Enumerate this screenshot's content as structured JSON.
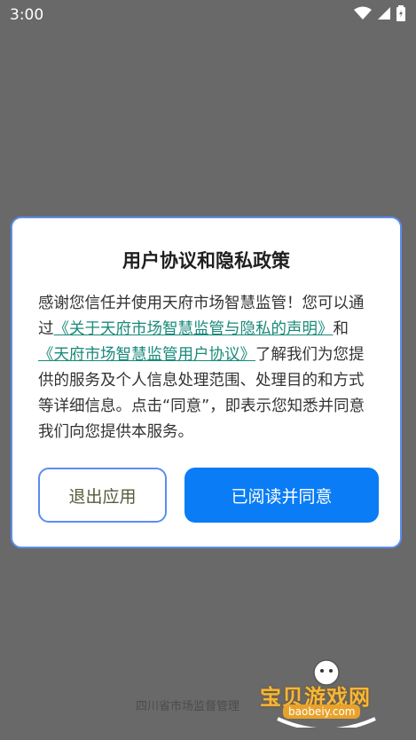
{
  "status_bar": {
    "time": "3:00"
  },
  "dialog": {
    "title": "用户协议和隐私政策",
    "body": {
      "intro": "感谢您信任并使用天府市场智慧监管！您可以通过",
      "link1": "《关于天府市场智慧监管与隐私的声明》",
      "connector": "和",
      "link2": "《天府市场智慧监管用户协议》",
      "rest": "了解我们为您提供的服务及个人信息处理范围、处理目的和方式等详细信息。点击“同意”，即表示您知悉并同意我们向您提供本服务。"
    },
    "exit_label": "退出应用",
    "agree_label": "已阅读并同意"
  },
  "footer": {
    "text": "四川省市场监督管理"
  },
  "watermark": {
    "text": "宝贝游戏网",
    "url": "baobeiy.com"
  },
  "colors": {
    "accent": "#0a7cf5",
    "link": "#1a8a7a",
    "border": "#5b8def",
    "overlay": "#696969"
  }
}
